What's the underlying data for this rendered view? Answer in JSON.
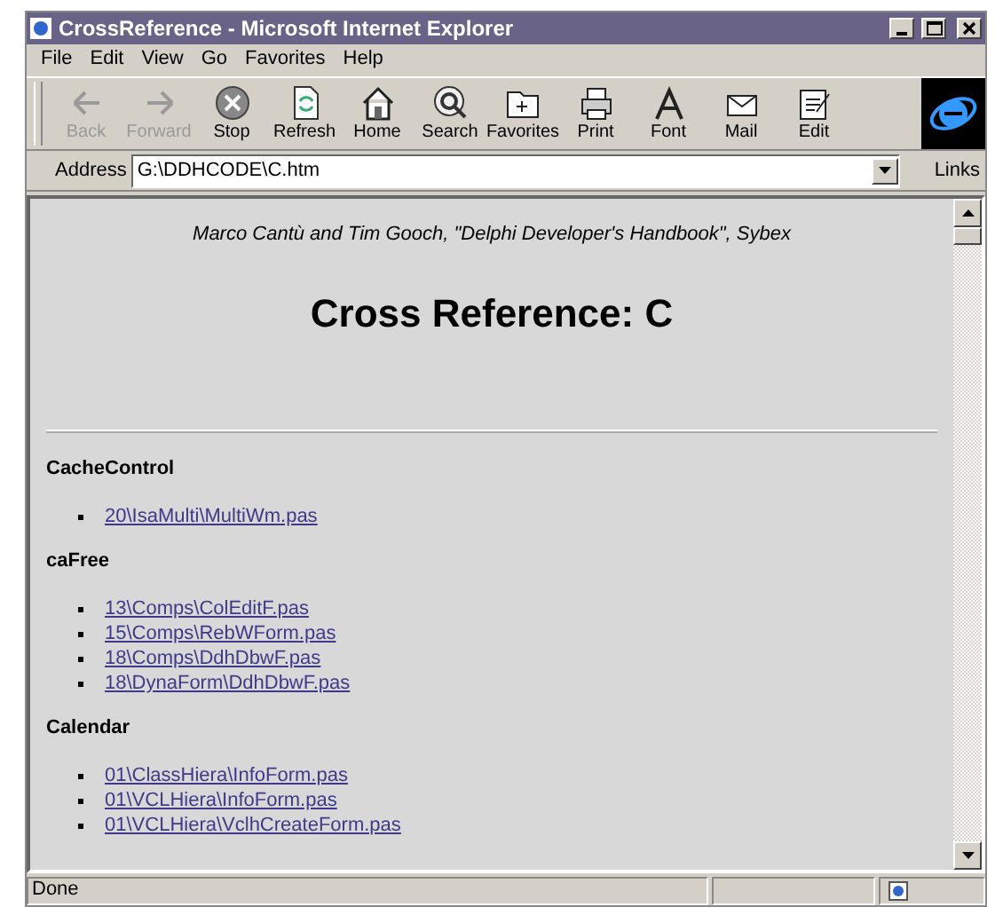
{
  "window": {
    "title": "CrossReference - Microsoft Internet Explorer"
  },
  "menu": [
    "File",
    "Edit",
    "View",
    "Go",
    "Favorites",
    "Help"
  ],
  "toolbar": [
    {
      "label": "Back",
      "kind": "back",
      "disabled": true
    },
    {
      "label": "Forward",
      "kind": "forward",
      "disabled": true
    },
    {
      "label": "Stop",
      "kind": "stop",
      "disabled": false
    },
    {
      "label": "Refresh",
      "kind": "refresh",
      "disabled": false
    },
    {
      "label": "Home",
      "kind": "home",
      "disabled": false
    },
    {
      "label": "Search",
      "kind": "search",
      "disabled": false
    },
    {
      "label": "Favorites",
      "kind": "favorites",
      "disabled": false
    },
    {
      "label": "Print",
      "kind": "print",
      "disabled": false
    },
    {
      "label": "Font",
      "kind": "font",
      "disabled": false
    },
    {
      "label": "Mail",
      "kind": "mail",
      "disabled": false
    },
    {
      "label": "Edit",
      "kind": "edit",
      "disabled": false
    }
  ],
  "address_bar": {
    "label": "Address",
    "value": "G:\\DDHCODE\\C.htm",
    "links": "Links"
  },
  "page": {
    "credit": "Marco Cantù and Tim Gooch, \"Delphi Developer's Handbook\", Sybex",
    "heading": "Cross Reference: C",
    "sections": [
      {
        "title": "CacheControl",
        "links": [
          "20\\IsaMulti\\MultiWm.pas"
        ]
      },
      {
        "title": "caFree",
        "links": [
          "13\\Comps\\ColEditF.pas",
          "15\\Comps\\RebWForm.pas",
          "18\\Comps\\DdhDbwF.pas",
          "18\\DynaForm\\DdhDbwF.pas"
        ]
      },
      {
        "title": "Calendar",
        "links": [
          "01\\ClassHiera\\InfoForm.pas",
          "01\\VCLHiera\\InfoForm.pas",
          "01\\VCLHiera\\VclhCreateForm.pas"
        ]
      }
    ]
  },
  "status_bar": {
    "text": "Done"
  }
}
